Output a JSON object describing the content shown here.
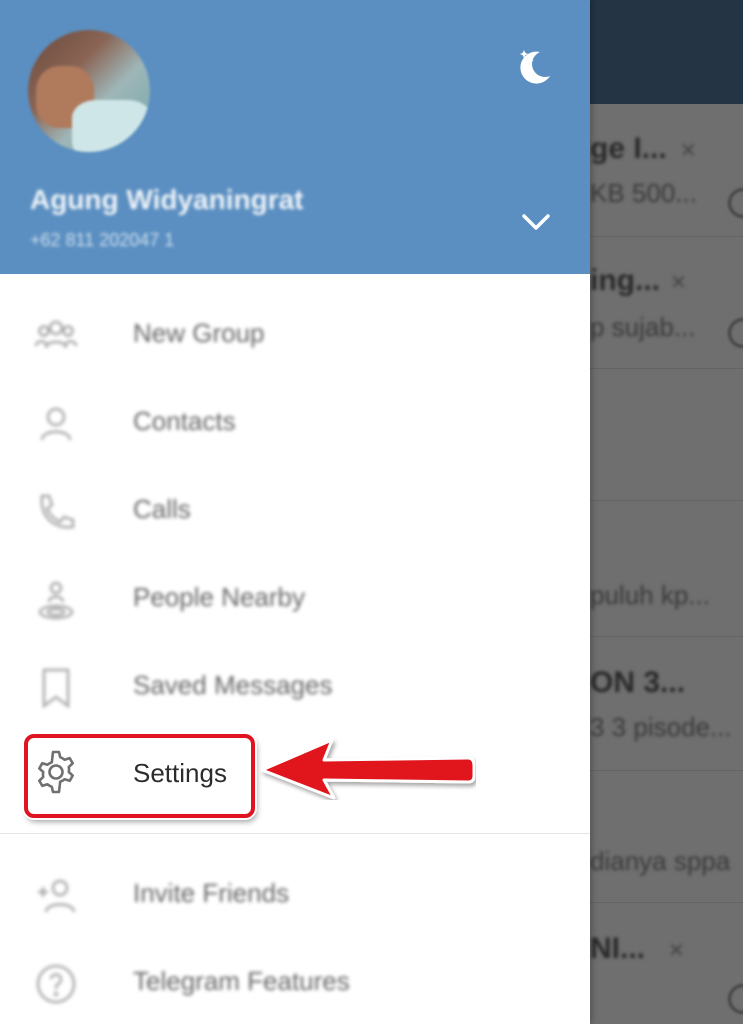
{
  "profile": {
    "name": "Agung Widyaningrat",
    "phone": "+62 811 202047 1"
  },
  "menu": {
    "items": [
      {
        "label": "New Group",
        "icon": "group-icon"
      },
      {
        "label": "Contacts",
        "icon": "contact-icon"
      },
      {
        "label": "Calls",
        "icon": "phone-icon"
      },
      {
        "label": "People Nearby",
        "icon": "people-nearby-icon"
      },
      {
        "label": "Saved Messages",
        "icon": "bookmark-icon"
      },
      {
        "label": "Settings",
        "icon": "gear-icon"
      }
    ],
    "bottom_items": [
      {
        "label": "Invite Friends",
        "icon": "add-user-icon"
      },
      {
        "label": "Telegram Features",
        "icon": "help-icon"
      }
    ]
  },
  "background_chats": {
    "lines": [
      {
        "text": "ge I...",
        "kind": "title"
      },
      {
        "text": "KB 500...",
        "kind": "sub"
      },
      {
        "text": "ing...",
        "kind": "title"
      },
      {
        "text": "p sujab...",
        "kind": "sub"
      },
      {
        "text": "puluh kp...",
        "kind": "sub"
      },
      {
        "text": "ON 3...",
        "kind": "title"
      },
      {
        "text": "3  3 pisode...",
        "kind": "sub"
      },
      {
        "text": "dianya sppa",
        "kind": "sub"
      },
      {
        "text": "NI...",
        "kind": "title"
      }
    ]
  },
  "colors": {
    "header": "#5b8fc1",
    "topbar": "#243444",
    "highlight": "#e0141e"
  }
}
